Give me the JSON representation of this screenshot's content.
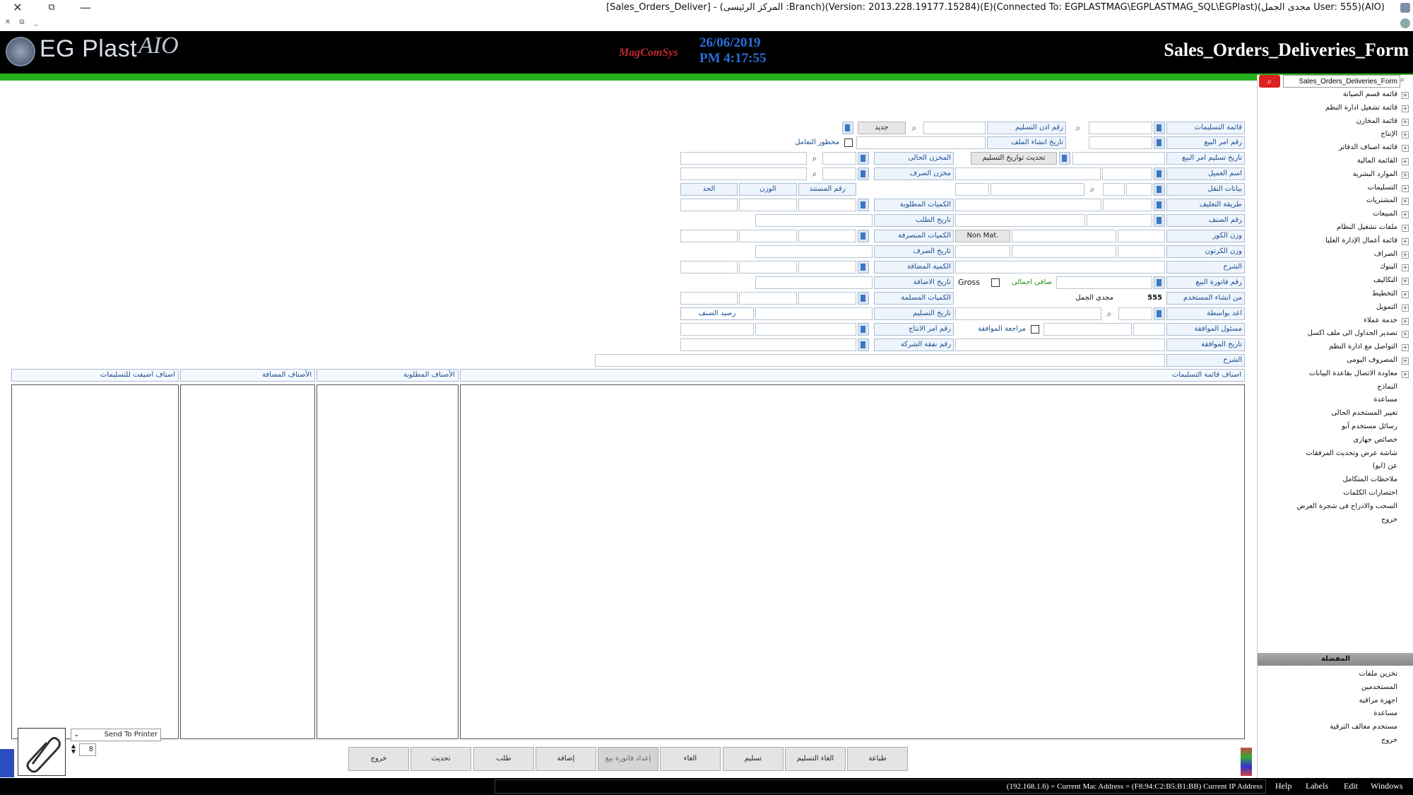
{
  "window": {
    "title": "[Sales_Orders_Deliver] - (المركز الرئيسى :Branch)(Version: 2013.228.19177.15284)(E)(Connected To: EGPLASTMAG\\EGPLASTMAG_SQL\\EGPlast)(مجدى الجمل User: 555)(AIO)"
  },
  "header": {
    "logo": "EG Plast",
    "logo_suffix": "AIO",
    "brand": "MagComSys",
    "date": "26/06/2019",
    "time": "PM 4:17:55",
    "form_name": "Sales_Orders_Deliveries_Form"
  },
  "form": {
    "labels": {
      "deliveries_list": "قائمة التسليمات",
      "delivery_order_no": "رقم اذن التسليم",
      "new": "جديد",
      "sales_order_no": "رقم امر البيع",
      "file_create_date": "تاريخ انشاء الملف",
      "blocked": "محظور التعامل",
      "sales_order_delivery_date": "تاريخ تسليم امر البيع",
      "update_delivery_dates": "تحديث تواريخ التسليم",
      "current_store": "المخزن الحالى",
      "customer_name": "اسم العميل",
      "issue_store": "مخزن الصرف",
      "transport_data": "بيانات النقل",
      "doc_no": "رقم المستند",
      "weight": "الوزن",
      "limit": "الحد",
      "packing_method": "طريقة التغليف",
      "required_qty": "الكميات المطلوبة",
      "item_no": "رقم الصنف",
      "request_date": "تاريخ الطلب",
      "core_weight": "وزن الكور",
      "non_mat": "Non Mat.",
      "issued_qty": "الكميات المنصرفة",
      "carton_weight": "وزن الكرتون",
      "issue_date": "تاريخ الصرف",
      "description": "الشرح",
      "added_qty": "الكمية المضافة",
      "sales_invoice_no": "رقم فاتورة البيع",
      "net_total": "صافى اجمالى",
      "gross": "Gross",
      "add_date": "تاريخ الاضافة",
      "created_by": "من انشاء المستخدم",
      "created_by_code": "555",
      "created_by_name": "مجدى الجمل",
      "delivered_qty": "الكميات المسلمة",
      "prepared_by": "اعد بواسطة",
      "delivery_date": "تاريخ التسليم",
      "item_balance": "رصيد الصنف",
      "approval_officer": "مسئول الموافقة",
      "approval_review": "مراجعة الموافقة",
      "production_order_no": "رقم امر الانتاج",
      "approval_date": "تاريخ الموافقة",
      "company_cost_no": "رقم نفقة الشركة",
      "description2": "الشرح"
    },
    "columns": {
      "delivery_list_items": "اصناف قائمة التسليمات",
      "required_items": "الأصناف المطلوبة",
      "added_items": "الأصناف المضافة",
      "added_to_deliveries": "اصناف اضيفت للتسليمات"
    }
  },
  "print": {
    "target": "Send To Printer",
    "copies": "8"
  },
  "buttons": {
    "print": "طباعة",
    "cancel_delivery": "الغاء التسليم",
    "deliver": "تسليم",
    "cancel": "الغاء",
    "prepare_invoice": "إعداد فاتورة بيع",
    "add": "إضافة",
    "request": "طلب",
    "update": "تحديث",
    "exit": "خروج"
  },
  "right_panel": {
    "search_value": "Sales_Orders_Deliveries_Form",
    "tree": [
      "قائمة قسم الصيانة",
      "قائمة تشغيل ادارة النظم",
      "قائمة المخازن",
      "الإنتاج",
      "قائمة اصناف الدفاتر",
      "القائمة المالية",
      "الموارد البشرية",
      "التسليمات",
      "المشتريات",
      "المبيعات",
      "ملفات تشغيل النظام",
      "قائمة أعمال الإدارة العليا",
      "الصراف",
      "البنوك",
      "التكاليف",
      "التخطيط",
      "التمويل",
      "خدمة عملاء",
      "تصدير الجداول الى ملف اكسل",
      "التواصل مع ادارة النظم",
      "المصروف اليومى",
      "معاودة الاتصال بقاعدة البيانات",
      "النماذج",
      "مساعدة",
      "تغيير المستخدم الحالى",
      "رسائل مستخدم آبو",
      "خصائص جهازى",
      "شاشة عرض وتحديث المرفقات",
      "عن (ايو)",
      "ملاحظات المتكامل",
      "اختصارات الكلمات",
      "السحب والادراج فى شجرة العرض",
      "خروج"
    ],
    "favorites_header": "المفضلة",
    "favorites": [
      "تخزين ملفات",
      "المستخدمين",
      "اجهزة مراقبة",
      "مساعدة",
      "مستخدم معالف الترقية",
      "خروج"
    ]
  },
  "statusbar": {
    "network": "(192.168.1.6) = Current Mac Address = (F8:94:C2:B5:B1:BB) Current IP Address",
    "menu": [
      "Help",
      "Labels",
      "Edit",
      "Windows"
    ]
  }
}
